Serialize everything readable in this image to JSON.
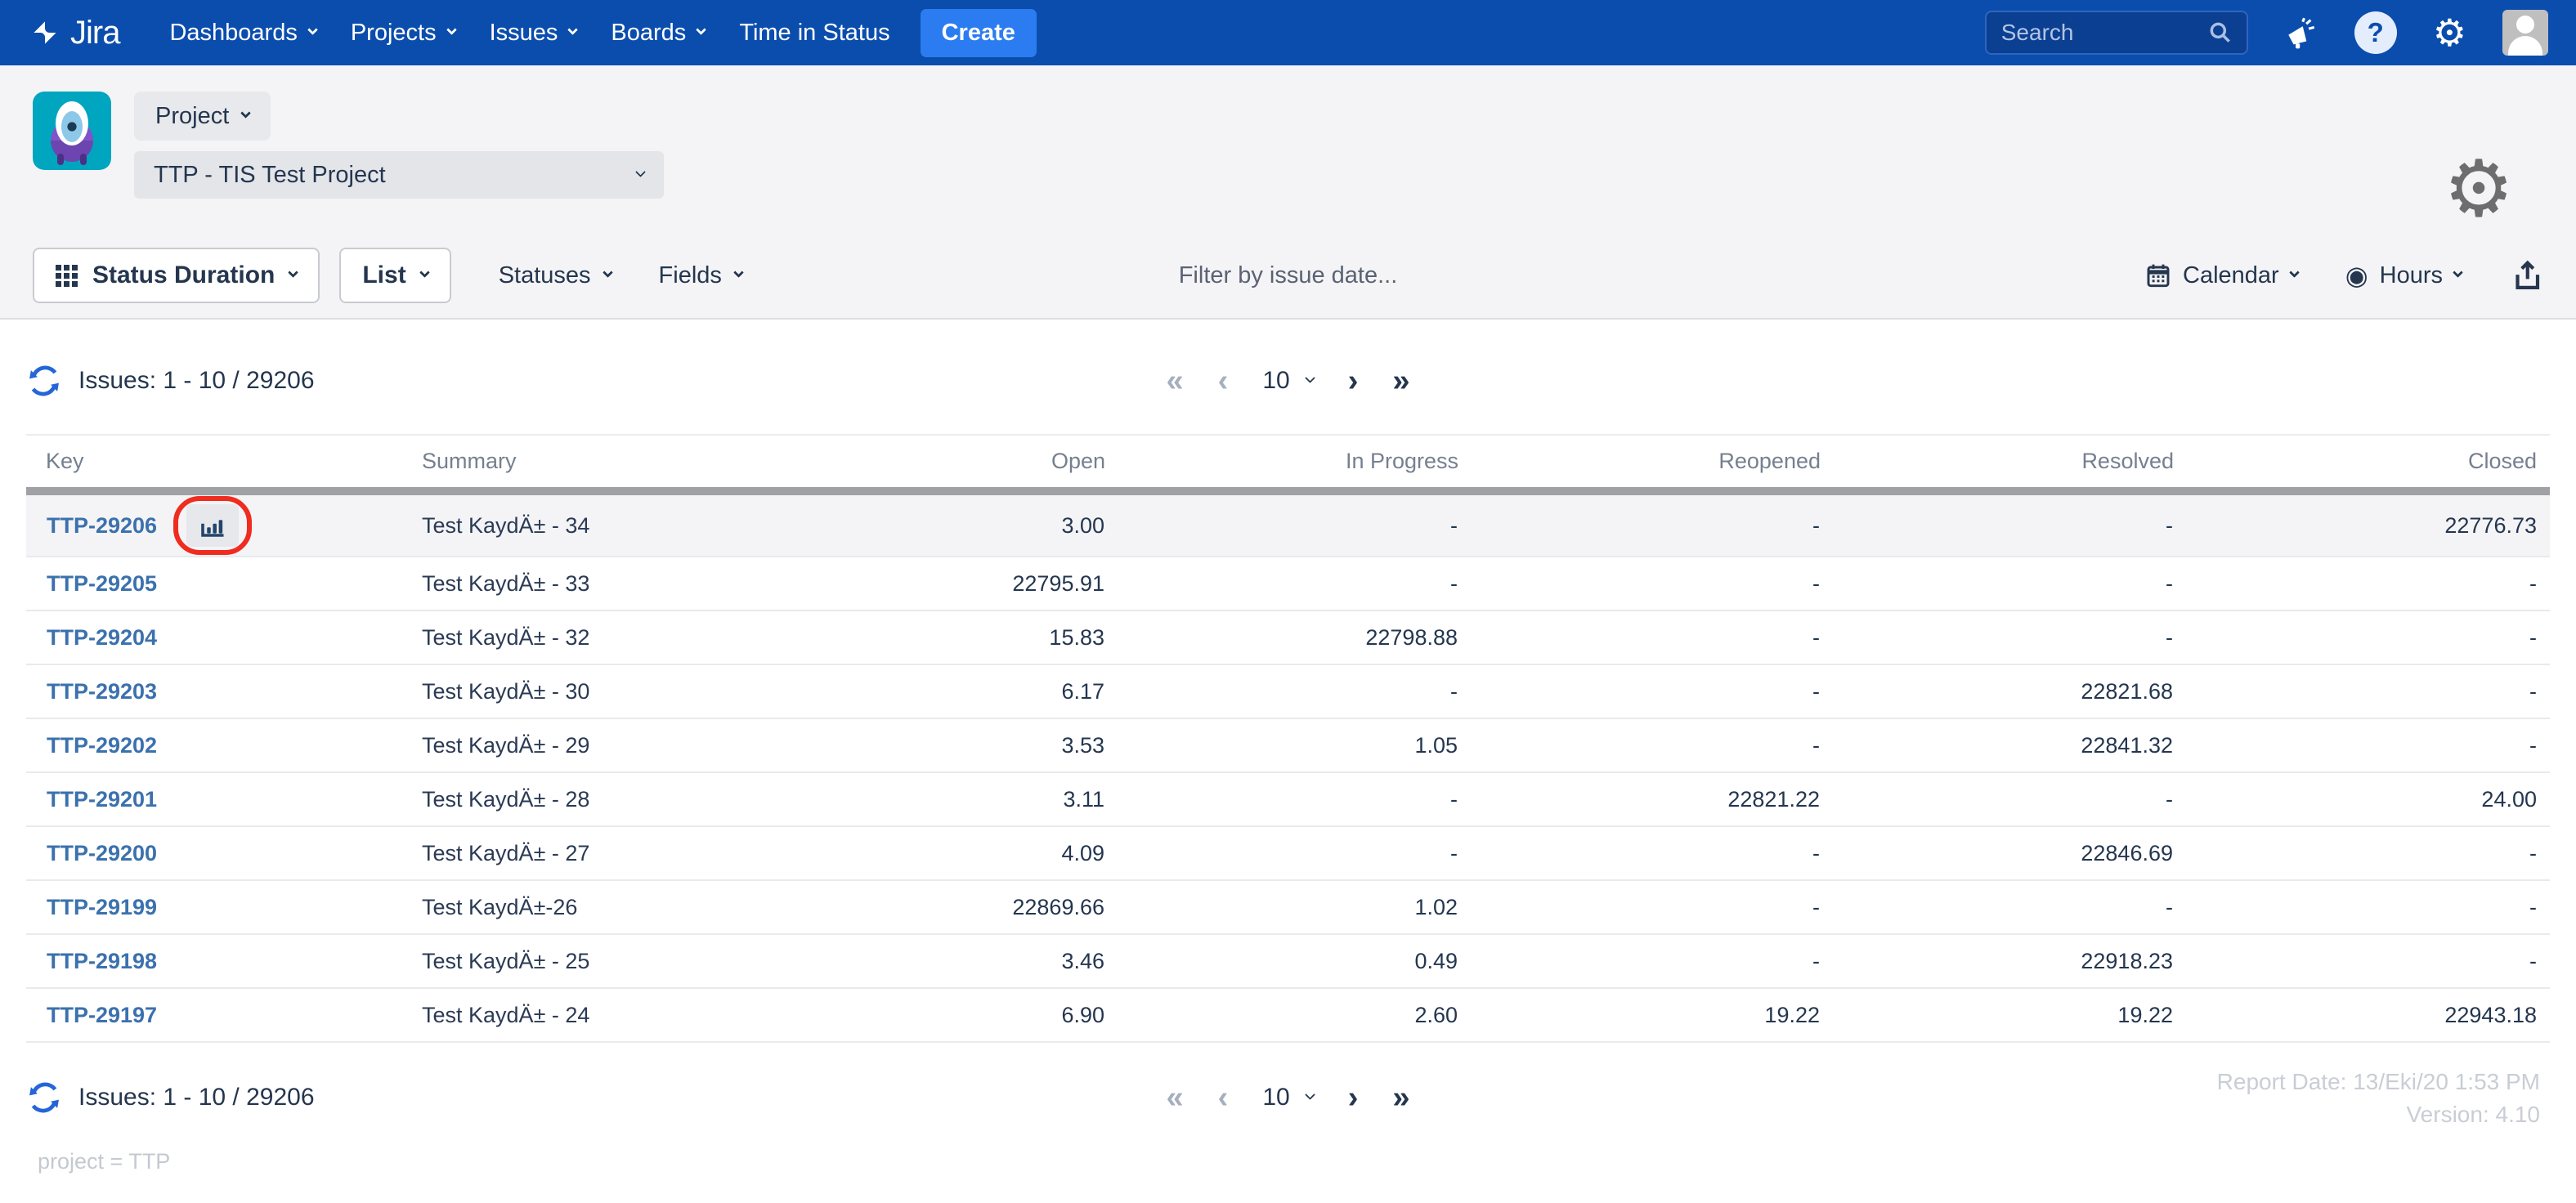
{
  "navbar": {
    "logo_text": "Jira",
    "items": [
      {
        "id": "dashboards",
        "label": "Dashboards",
        "has_caret": true
      },
      {
        "id": "projects",
        "label": "Projects",
        "has_caret": true
      },
      {
        "id": "issues",
        "label": "Issues",
        "has_caret": true
      },
      {
        "id": "boards",
        "label": "Boards",
        "has_caret": true
      },
      {
        "id": "time-in-status",
        "label": "Time in Status",
        "has_caret": false
      }
    ],
    "create_label": "Create",
    "search_placeholder": "Search"
  },
  "project_header": {
    "project_button_label": "Project",
    "project_select_value": "TTP - TIS Test Project"
  },
  "toolbar": {
    "report_type_label": "Status Duration",
    "view_label": "List",
    "statuses_label": "Statuses",
    "fields_label": "Fields",
    "filter_placeholder": "Filter by issue date...",
    "calendar_label": "Calendar",
    "hours_label": "Hours"
  },
  "issues_summary": "Issues: 1 - 10 / 29206",
  "pagination": {
    "first": "«",
    "previous": "‹",
    "page_size": "10",
    "next": "›",
    "last": "»"
  },
  "table": {
    "columns": [
      "Key",
      "Summary",
      "Open",
      "In Progress",
      "Reopened",
      "Resolved",
      "Closed"
    ],
    "rows": [
      {
        "key": "TTP-29206",
        "summary": "Test KaydÄ± - 34",
        "open": "3.00",
        "in_progress": "-",
        "reopened": "-",
        "resolved": "-",
        "closed": "22776.73",
        "has_chart_icon": true
      },
      {
        "key": "TTP-29205",
        "summary": "Test KaydÄ± - 33",
        "open": "22795.91",
        "in_progress": "-",
        "reopened": "-",
        "resolved": "-",
        "closed": "-"
      },
      {
        "key": "TTP-29204",
        "summary": "Test KaydÄ± - 32",
        "open": "15.83",
        "in_progress": "22798.88",
        "reopened": "-",
        "resolved": "-",
        "closed": "-"
      },
      {
        "key": "TTP-29203",
        "summary": "Test KaydÄ± - 30",
        "open": "6.17",
        "in_progress": "-",
        "reopened": "-",
        "resolved": "22821.68",
        "closed": "-"
      },
      {
        "key": "TTP-29202",
        "summary": "Test KaydÄ± - 29",
        "open": "3.53",
        "in_progress": "1.05",
        "reopened": "-",
        "resolved": "22841.32",
        "closed": "-"
      },
      {
        "key": "TTP-29201",
        "summary": "Test KaydÄ± - 28",
        "open": "3.11",
        "in_progress": "-",
        "reopened": "22821.22",
        "resolved": "-",
        "closed": "24.00"
      },
      {
        "key": "TTP-29200",
        "summary": "Test KaydÄ± - 27",
        "open": "4.09",
        "in_progress": "-",
        "reopened": "-",
        "resolved": "22846.69",
        "closed": "-"
      },
      {
        "key": "TTP-29199",
        "summary": "Test KaydÄ±-26",
        "open": "22869.66",
        "in_progress": "1.02",
        "reopened": "-",
        "resolved": "-",
        "closed": "-"
      },
      {
        "key": "TTP-29198",
        "summary": "Test KaydÄ± - 25",
        "open": "3.46",
        "in_progress": "0.49",
        "reopened": "-",
        "resolved": "22918.23",
        "closed": "-"
      },
      {
        "key": "TTP-29197",
        "summary": "Test KaydÄ± - 24",
        "open": "6.90",
        "in_progress": "2.60",
        "reopened": "19.22",
        "resolved": "19.22",
        "closed": "22943.18"
      }
    ]
  },
  "footer": {
    "report_date": "Report Date: 13/Eki/20 1:53 PM",
    "version": "Version: 4.10",
    "jql": "project = TTP"
  },
  "colors": {
    "navbar_blue": "#0b4dad",
    "create_blue": "#2b7cf0",
    "link_blue": "#3b71ad",
    "annotation_red": "#ef2c1f",
    "refresh_blue": "#2565d8",
    "project_avatar_teal": "#00a5bf",
    "band_gray": "#f4f4f6"
  }
}
